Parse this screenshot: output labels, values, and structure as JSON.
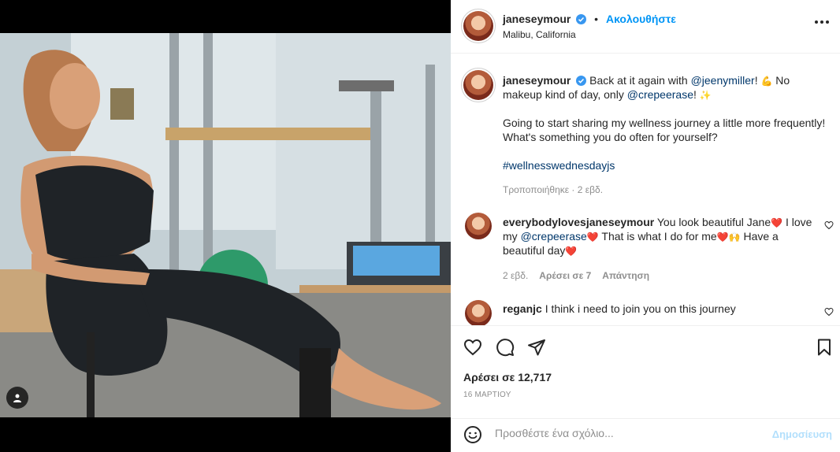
{
  "post": {
    "author": "janeseymour",
    "follow_label": "Ακολουθήστε",
    "location": "Malibu, California",
    "caption": {
      "text_1": "Back at it again with",
      "mention_1": "@jeenymiller",
      "text_2": "! ",
      "emoji_1": "💪",
      "text_3": " No makeup kind of day, only",
      "mention_2": "@crepeerase",
      "text_4": "! ",
      "emoji_2": "✨",
      "paragraph_2": "Going to start sharing my wellness journey a little more frequently! What's something you do often for yourself?",
      "hashtag": "#wellnesswednesdayjs"
    },
    "edited_label": "Τροποποιήθηκε · 2 εβδ.",
    "likes_label": "Αρέσει σε 12,717",
    "date_label": "16 ΜΑΡΤΙΟΥ"
  },
  "comments": [
    {
      "user": "everybodylovesjaneseymour",
      "text_a": "You look beautiful Jane",
      "emoji_a": "❤️",
      "text_b": " I love my",
      "mention": "@crepeerase",
      "emoji_b": "❤️",
      "text_c": " That is what I do for me",
      "emoji_c": "❤️🙌",
      "text_d": " Have a beautiful day",
      "emoji_d": "❤️",
      "age": "2 εβδ.",
      "likes": "Αρέσει σε 7",
      "reply": "Απάντηση"
    },
    {
      "user": "reganjc",
      "text": "I think i need to join you on this journey"
    }
  ],
  "comment_box": {
    "placeholder": "Προσθέστε ένα σχόλιο...",
    "post_label": "Δημοσίευση"
  },
  "icons": {
    "like": "heart-icon",
    "comment": "comment-icon",
    "share": "share-icon",
    "save": "bookmark-icon",
    "emoji": "smile-icon",
    "more": "more-options-icon",
    "verified": "verified-badge-icon",
    "tag": "user-tag-icon"
  },
  "colors": {
    "accent": "#0095f6",
    "link": "#00376b",
    "muted": "#8e8e8e",
    "post_disabled": "#b2dffc",
    "heart": "#ed4956"
  }
}
